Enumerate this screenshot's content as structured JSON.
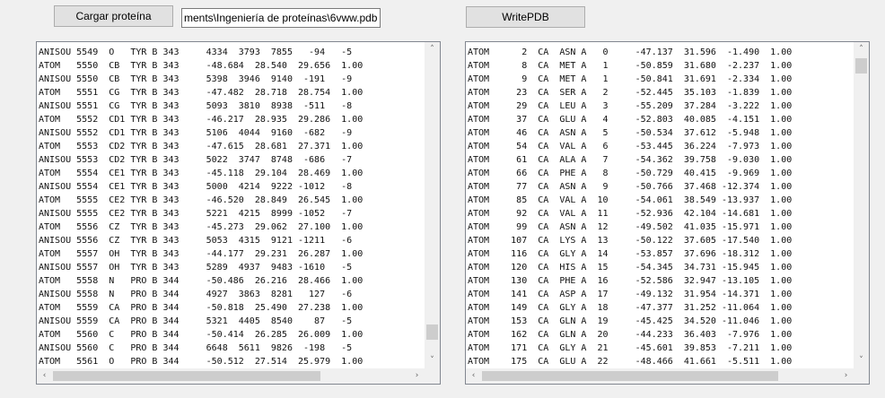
{
  "toolbar": {
    "load_label": "Cargar proteína",
    "path_value": "ments\\Ingeniería de proteínas\\6vww.pdb",
    "write_label": "WritePDB"
  },
  "scroll": {
    "up": "˄",
    "down": "˅",
    "left": "‹",
    "right": "›"
  },
  "left_lines": [
    "ANISOU 5549  O   TYR B 343     4334  3793  7855   -94   -5",
    "ATOM   5550  CB  TYR B 343     -48.684  28.540  29.656  1.00",
    "ANISOU 5550  CB  TYR B 343     5398  3946  9140  -191   -9",
    "ATOM   5551  CG  TYR B 343     -47.482  28.718  28.754  1.00",
    "ANISOU 5551  CG  TYR B 343     5093  3810  8938  -511   -8",
    "ATOM   5552  CD1 TYR B 343     -46.217  28.935  29.286  1.00",
    "ANISOU 5552  CD1 TYR B 343     5106  4044  9160  -682   -9",
    "ATOM   5553  CD2 TYR B 343     -47.615  28.681  27.371  1.00",
    "ANISOU 5553  CD2 TYR B 343     5022  3747  8748  -686   -7",
    "ATOM   5554  CE1 TYR B 343     -45.118  29.104  28.469  1.00",
    "ANISOU 5554  CE1 TYR B 343     5000  4214  9222 -1012   -8",
    "ATOM   5555  CE2 TYR B 343     -46.520  28.849  26.545  1.00",
    "ANISOU 5555  CE2 TYR B 343     5221  4215  8999 -1052   -7",
    "ATOM   5556  CZ  TYR B 343     -45.273  29.062  27.100  1.00",
    "ANISOU 5556  CZ  TYR B 343     5053  4315  9121 -1211   -6",
    "ATOM   5557  OH  TYR B 343     -44.177  29.231  26.287  1.00",
    "ANISOU 5557  OH  TYR B 343     5289  4937  9483 -1610   -5",
    "ATOM   5558  N   PRO B 344     -50.486  26.216  28.466  1.00",
    "ANISOU 5558  N   PRO B 344     4927  3863  8281   127   -6",
    "ATOM   5559  CA  PRO B 344     -50.818  25.490  27.238  1.00",
    "ANISOU 5559  CA  PRO B 344     5321  4405  8540    87   -5",
    "ATOM   5560  C   PRO B 344     -50.414  26.285  26.009  1.00",
    "ANISOU 5560  C   PRO B 344     6648  5611  9826  -198   -5",
    "ATOM   5561  O   PRO B 344     -50.512  27.514  25.979  1.00"
  ],
  "right_lines": [
    "ATOM      2  CA  ASN A   0     -47.137  31.596  -1.490  1.00",
    "ATOM      8  CA  MET A   1     -50.859  31.680  -2.237  1.00",
    "ATOM      9  CA  MET A   1     -50.841  31.691  -2.334  1.00",
    "ATOM     23  CA  SER A   2     -52.445  35.103  -1.839  1.00",
    "ATOM     29  CA  LEU A   3     -55.209  37.284  -3.222  1.00",
    "ATOM     37  CA  GLU A   4     -52.803  40.085  -4.151  1.00",
    "ATOM     46  CA  ASN A   5     -50.534  37.612  -5.948  1.00",
    "ATOM     54  CA  VAL A   6     -53.445  36.224  -7.973  1.00",
    "ATOM     61  CA  ALA A   7     -54.362  39.758  -9.030  1.00",
    "ATOM     66  CA  PHE A   8     -50.729  40.415  -9.969  1.00",
    "ATOM     77  CA  ASN A   9     -50.766  37.468 -12.374  1.00",
    "ATOM     85  CA  VAL A  10     -54.061  38.549 -13.937  1.00",
    "ATOM     92  CA  VAL A  11     -52.936  42.104 -14.681  1.00",
    "ATOM     99  CA  ASN A  12     -49.502  41.035 -15.971  1.00",
    "ATOM    107  CA  LYS A  13     -50.122  37.605 -17.540  1.00",
    "ATOM    116  CA  GLY A  14     -53.857  37.696 -18.312  1.00",
    "ATOM    120  CA  HIS A  15     -54.345  34.731 -15.945  1.00",
    "ATOM    130  CA  PHE A  16     -52.586  32.947 -13.105  1.00",
    "ATOM    141  CA  ASP A  17     -49.132  31.954 -14.371  1.00",
    "ATOM    149  CA  GLY A  18     -47.377  31.252 -11.064  1.00",
    "ATOM    153  CA  GLN A  19     -45.425  34.520 -11.046  1.00",
    "ATOM    162  CA  GLN A  20     -44.233  36.403  -7.976  1.00",
    "ATOM    171  CA  GLY A  21     -45.601  39.853  -7.211  1.00",
    "ATOM    175  CA  GLU A  22     -48.466  41.661  -5.511  1.00"
  ]
}
